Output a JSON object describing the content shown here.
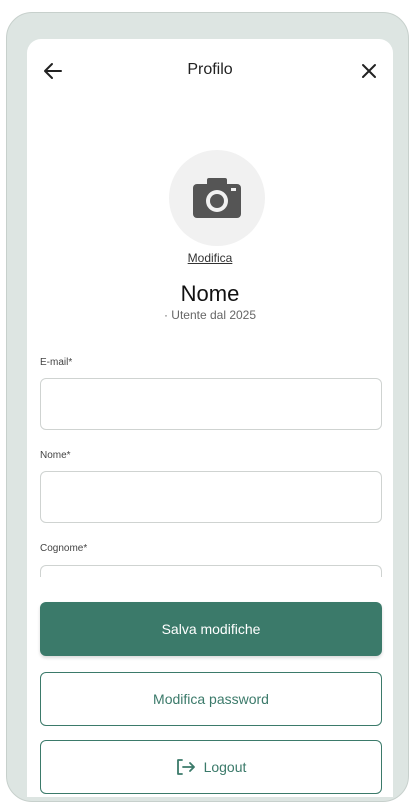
{
  "header": {
    "title": "Profilo",
    "back_icon": "arrow-left-icon",
    "close_icon": "close-icon"
  },
  "profile": {
    "avatar_icon": "camera-icon",
    "edit_label": "Modifica",
    "name": "Nome",
    "member_since": "· Utente dal 2025"
  },
  "form": {
    "email_label": "E-mail*",
    "email_value": "",
    "first_name_label": "Nome*",
    "first_name_value": "",
    "last_name_label": "Cognome*",
    "last_name_value": ""
  },
  "actions": {
    "save_label": "Salva modifiche",
    "change_password_label": "Modifica password",
    "logout_label": "Logout",
    "logout_icon": "logout-icon"
  },
  "colors": {
    "accent": "#3b7a6a",
    "frame": "#dde5e2"
  }
}
